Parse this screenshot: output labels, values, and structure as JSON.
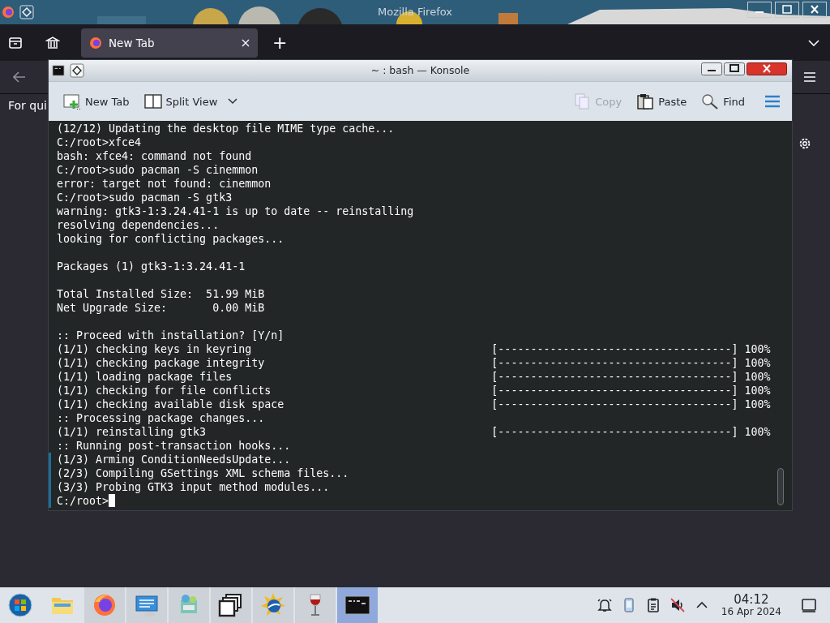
{
  "firefox": {
    "title": "Mozilla Firefox",
    "tabs": [
      {
        "label": "New Tab",
        "selected": true
      }
    ],
    "new_tab_button": "+",
    "page_text": "For qui"
  },
  "konsole": {
    "title": "~ : bash — Konsole",
    "toolbar": [
      {
        "kind": "new-tab",
        "label": "New Tab",
        "disabled": false
      },
      {
        "kind": "split-view",
        "label": "Split View",
        "disabled": false
      },
      {
        "kind": "copy",
        "label": "Copy",
        "disabled": true
      },
      {
        "kind": "paste",
        "label": "Paste",
        "disabled": false
      },
      {
        "kind": "find",
        "label": "Find",
        "disabled": false
      }
    ],
    "lines": [
      {
        "kind": "text",
        "text": "(12/12) Updating the desktop file MIME type cache...",
        "marked": false
      },
      {
        "kind": "text",
        "text": "C:/root>xfce4",
        "marked": false
      },
      {
        "kind": "text",
        "text": "bash: xfce4: command not found",
        "marked": false
      },
      {
        "kind": "text",
        "text": "C:/root>sudo pacman -S cinemmon",
        "marked": false
      },
      {
        "kind": "text",
        "text": "error: target not found: cinemmon",
        "marked": false
      },
      {
        "kind": "text",
        "text": "C:/root>sudo pacman -S gtk3",
        "marked": false
      },
      {
        "kind": "text",
        "text": "warning: gtk3-1:3.24.41-1 is up to date -- reinstalling",
        "marked": false
      },
      {
        "kind": "text",
        "text": "resolving dependencies...",
        "marked": false
      },
      {
        "kind": "text",
        "text": "looking for conflicting packages...",
        "marked": false
      },
      {
        "kind": "blank",
        "marked": false
      },
      {
        "kind": "text",
        "text": "Packages (1) gtk3-1:3.24.41-1",
        "marked": false
      },
      {
        "kind": "blank",
        "marked": false
      },
      {
        "kind": "text",
        "text": "Total Installed Size:  51.99 MiB",
        "marked": false
      },
      {
        "kind": "text",
        "text": "Net Upgrade Size:       0.00 MiB",
        "marked": false
      },
      {
        "kind": "blank",
        "marked": false
      },
      {
        "kind": "text",
        "text": ":: Proceed with installation? [Y/n]",
        "marked": false
      },
      {
        "kind": "progress",
        "text": "(1/1) checking keys in keyring",
        "bar": "[------------------------------------]",
        "percent": "100%",
        "marked": false
      },
      {
        "kind": "progress",
        "text": "(1/1) checking package integrity",
        "bar": "[------------------------------------]",
        "percent": "100%",
        "marked": false
      },
      {
        "kind": "progress",
        "text": "(1/1) loading package files",
        "bar": "[------------------------------------]",
        "percent": "100%",
        "marked": false
      },
      {
        "kind": "progress",
        "text": "(1/1) checking for file conflicts",
        "bar": "[------------------------------------]",
        "percent": "100%",
        "marked": false
      },
      {
        "kind": "progress",
        "text": "(1/1) checking available disk space",
        "bar": "[------------------------------------]",
        "percent": "100%",
        "marked": false
      },
      {
        "kind": "text",
        "text": ":: Processing package changes...",
        "marked": false
      },
      {
        "kind": "progress",
        "text": "(1/1) reinstalling gtk3",
        "bar": "[------------------------------------]",
        "percent": "100%",
        "marked": false
      },
      {
        "kind": "text",
        "text": ":: Running post-transaction hooks...",
        "marked": false
      },
      {
        "kind": "text",
        "text": "(1/3) Arming ConditionNeedsUpdate...",
        "marked": true
      },
      {
        "kind": "text",
        "text": "(2/3) Compiling GSettings XML schema files...",
        "marked": true
      },
      {
        "kind": "text",
        "text": "(3/3) Probing GTK3 input method modules...",
        "marked": true
      },
      {
        "kind": "prompt",
        "text": "C:/root>",
        "marked": true
      }
    ]
  },
  "taskbar": {
    "apps": [
      {
        "kind": "start",
        "running": false,
        "selected": false
      },
      {
        "kind": "files",
        "running": false,
        "selected": false
      },
      {
        "kind": "firefox",
        "running": true,
        "selected": false
      },
      {
        "kind": "monitor",
        "running": true,
        "selected": false
      },
      {
        "kind": "installer",
        "running": true,
        "selected": false
      },
      {
        "kind": "windows",
        "running": true,
        "selected": false
      },
      {
        "kind": "globe",
        "running": true,
        "selected": false
      },
      {
        "kind": "wine",
        "running": true,
        "selected": false
      },
      {
        "kind": "terminal",
        "running": true,
        "selected": true
      }
    ],
    "tray": [
      {
        "kind": "bell"
      },
      {
        "kind": "phone"
      },
      {
        "kind": "clipboard"
      },
      {
        "kind": "muted"
      },
      {
        "kind": "caret"
      }
    ],
    "clock": {
      "time": "04:12",
      "date": "16 Apr 2024"
    }
  }
}
